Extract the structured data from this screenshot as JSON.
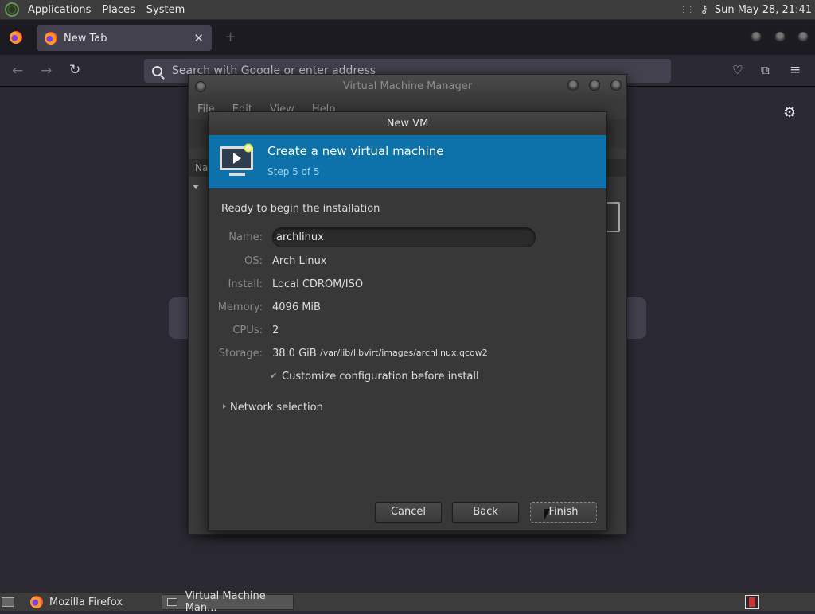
{
  "top_panel": {
    "menus": [
      "Applications",
      "Places",
      "System"
    ],
    "clock": "Sun May 28, 21:41"
  },
  "firefox": {
    "tab_label": "New Tab",
    "url_placeholder": "Search with Google or enter address"
  },
  "vmm": {
    "title": "Virtual Machine Manager",
    "menus": [
      "File",
      "Edit",
      "View",
      "Help"
    ],
    "column_header": "Na"
  },
  "dialog": {
    "title": "New VM",
    "banner_title": "Create a new virtual machine",
    "banner_step": "Step 5 of 5",
    "ready_text": "Ready to begin the installation",
    "fields": {
      "name_label": "Name:",
      "name_value": "archlinux",
      "os_label": "OS:",
      "os_value": "Arch Linux",
      "install_label": "Install:",
      "install_value": "Local CDROM/ISO",
      "memory_label": "Memory:",
      "memory_value": "4096 MiB",
      "cpus_label": "CPUs:",
      "cpus_value": "2",
      "storage_label": "Storage:",
      "storage_value": "38.0 GiB",
      "storage_path": "/var/lib/libvirt/images/archlinux.qcow2"
    },
    "customize_label": "Customize configuration before install",
    "customize_checked": true,
    "network_label": "Network selection",
    "buttons": {
      "cancel": "Cancel",
      "back": "Back",
      "finish": "Finish"
    }
  },
  "taskbar": {
    "items": [
      "Mozilla Firefox",
      "Virtual Machine Man..."
    ]
  }
}
